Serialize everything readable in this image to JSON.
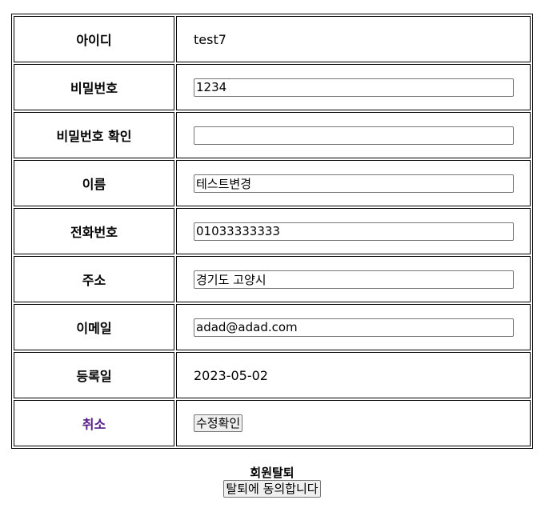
{
  "form": {
    "id": {
      "label": "아이디",
      "value": "test7"
    },
    "password": {
      "label": "비밀번호",
      "value": "1234"
    },
    "password_confirm": {
      "label": "비밀번호 확인",
      "value": ""
    },
    "name": {
      "label": "이름",
      "value": "테스트변경"
    },
    "phone": {
      "label": "전화번호",
      "value": "01033333333"
    },
    "address": {
      "label": "주소",
      "value": "경기도 고양시"
    },
    "email": {
      "label": "이메일",
      "value": "adad@adad.com"
    },
    "registered": {
      "label": "등록일",
      "value": "2023-05-02"
    },
    "cancel_label": "취소",
    "submit_label": "수정확인"
  },
  "withdraw": {
    "title": "회원탈퇴",
    "button_label": "탈퇴에 동의합니다"
  },
  "colors": {
    "link_visited": "#551a8b",
    "border": "#000000"
  }
}
